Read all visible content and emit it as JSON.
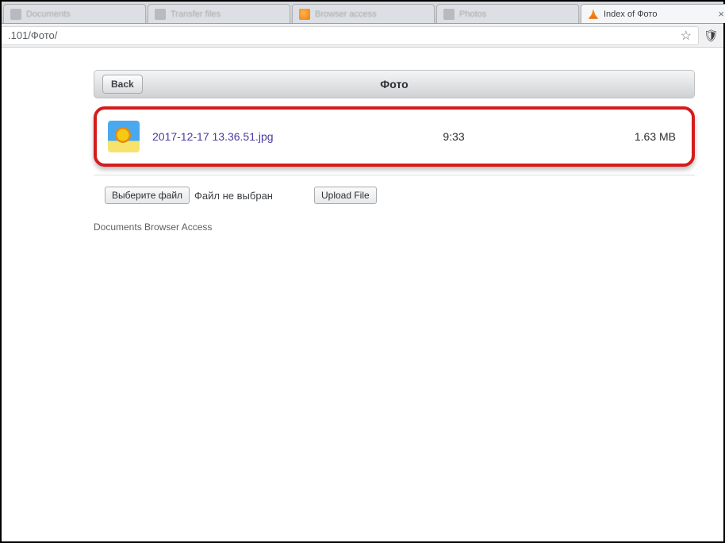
{
  "browser": {
    "tabs": {
      "bg1_label": "Documents",
      "bg2_label": "Transfer files",
      "bg3_label": "Browser access",
      "bg4_label": "Photos",
      "active_label": "Index of Фото"
    },
    "url": ".101/Фото/"
  },
  "navbar": {
    "back_label": "Back",
    "title": "Фото"
  },
  "file": {
    "name": "2017-12-17 13.36.51.jpg",
    "time": "9:33",
    "size": "1.63 MB"
  },
  "upload": {
    "choose_label": "Выберите файл",
    "none_selected": "Файл не выбран",
    "upload_label": "Upload File"
  },
  "footer": {
    "note": "Documents Browser Access"
  }
}
